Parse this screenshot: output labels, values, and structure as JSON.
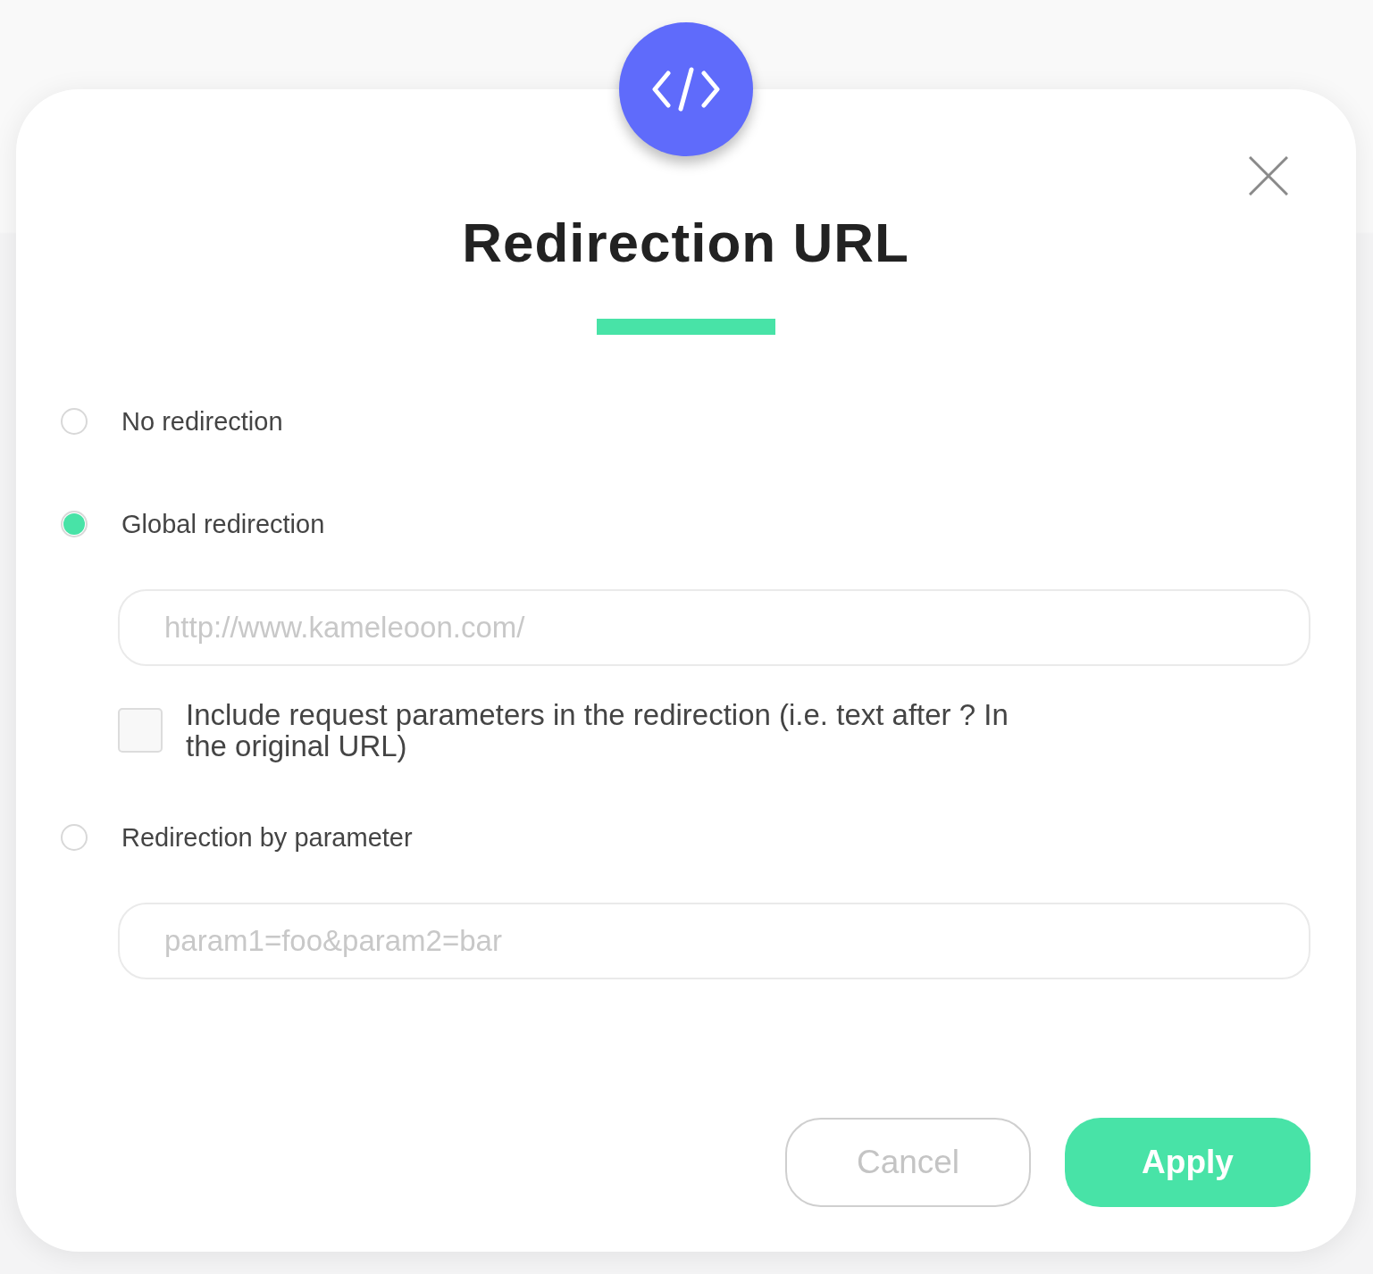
{
  "dialog": {
    "title": "Redirection URL",
    "options": [
      {
        "kind": "radio",
        "label": "No redirection",
        "selected": false
      },
      {
        "kind": "radio",
        "label": "Global redirection",
        "selected": true
      },
      {
        "kind": "field",
        "placeholder": "http://www.kameleoon.com/"
      },
      {
        "kind": "checkbox",
        "label": "Include request parameters in the redirection (i.e. text after ? In the original URL)",
        "checked": false
      },
      {
        "kind": "radio",
        "label": "Redirection by parameter",
        "selected": false
      },
      {
        "kind": "field",
        "placeholder": "param1=foo&param2=bar"
      }
    ],
    "buttons": [
      {
        "label": "Cancel",
        "kind": "secondary"
      },
      {
        "label": "Apply",
        "kind": "primary"
      }
    ]
  }
}
